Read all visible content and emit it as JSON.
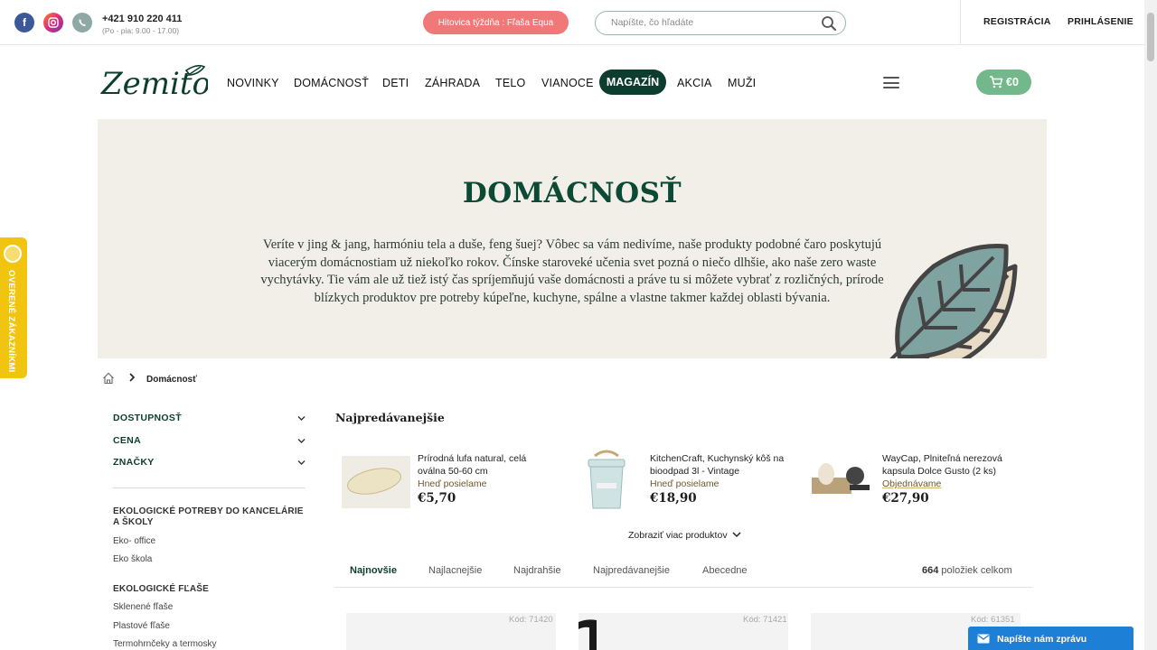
{
  "header": {
    "phone": "+421 910 220 411",
    "hours": "(Po - pia: 9.00 - 17.00)",
    "promo": "Hitovica týždňa : Fľaša Equa",
    "search_placeholder": "Napíšte, čo hľadáte",
    "register": "REGISTRÁCIA",
    "login": "PRIHLÁSENIE"
  },
  "nav": {
    "logo": "Zemito",
    "items": [
      "NOVINKY",
      "DOMÁCNOSŤ",
      "DETI",
      "ZÁHRADA",
      "TELO",
      "VIANOCE",
      "MAGAZÍN",
      "AKCIA",
      "MUŽI"
    ],
    "cart": "€0"
  },
  "hero": {
    "title": "DOMÁCNOSŤ",
    "text": "Veríte v jing & jang, harmóniu tela a duše, feng šuej? Vôbec sa vám nedivíme, naše produkty podobné čaro poskytujú viacerým domácnostiam už niekoľko rokov. Čínske staroveké učenia svet pozná o niečo dlhšie, ako naše zero waste vychytávky. Tie vám ale už tiež istý čas spríjemňujú vaše domácnosti a práve tu si môžete vybrať z rozličných, prírode blízkych produktov pre potreby kúpeľne, kuchyne, spálne a vlastne takmer každej oblasti bývania."
  },
  "verified_badge": "OVERENÉ ZÁKAZNÍKMI",
  "breadcrumb": {
    "current": "Domácnosť"
  },
  "sidebar": {
    "filters": [
      "DOSTUPNOSŤ",
      "CENA",
      "ZNAČKY"
    ],
    "categories": [
      {
        "title": "EKOLOGICKÉ POTREBY DO KANCELÁRIE A ŠKOLY",
        "items": [
          "Eko- office",
          "Eko škola"
        ]
      },
      {
        "title": "EKOLOGICKÉ FĽAŠE",
        "items": [
          "Sklenené fľaše",
          "Plastové fľaše",
          "Termohrnčeky a termosky"
        ]
      }
    ]
  },
  "bestsellers": {
    "title": "Najpredávanejšie",
    "products": [
      {
        "name": "Prírodná lufa natural, celá oválna 50-60 cm",
        "availability": "Hneď posielame",
        "price": "€5,70"
      },
      {
        "name": "KitchenCraft, Kuchynský kôš na bioodpad 3l - Vintage",
        "availability": "Hneď posielame",
        "price": "€18,90"
      },
      {
        "name": "WayCap, Plniteľná nerezová kapsula Dolce Gusto (2 ks)",
        "availability": "Objednávame",
        "price": "€27,90"
      }
    ],
    "show_more": "Zobraziť viac produktov"
  },
  "sort": {
    "tabs": [
      "Najnovšie",
      "Najlacnejšie",
      "Najdrahšie",
      "Najpredávanejšie",
      "Abecedne"
    ],
    "count_num": "664",
    "count_label": "položiek celkom"
  },
  "cards": [
    {
      "code": "Kód: 71420"
    },
    {
      "code": "Kód: 71421"
    },
    {
      "code": "Kód: 61351"
    }
  ],
  "chat": "Napíšte nám zprávu",
  "colors": {
    "brand_dark": "#0d3d2e",
    "promo": "#f07878",
    "cart": "#72b88a",
    "hero_bg": "#f2efe8",
    "chat": "#1e7fd6"
  }
}
